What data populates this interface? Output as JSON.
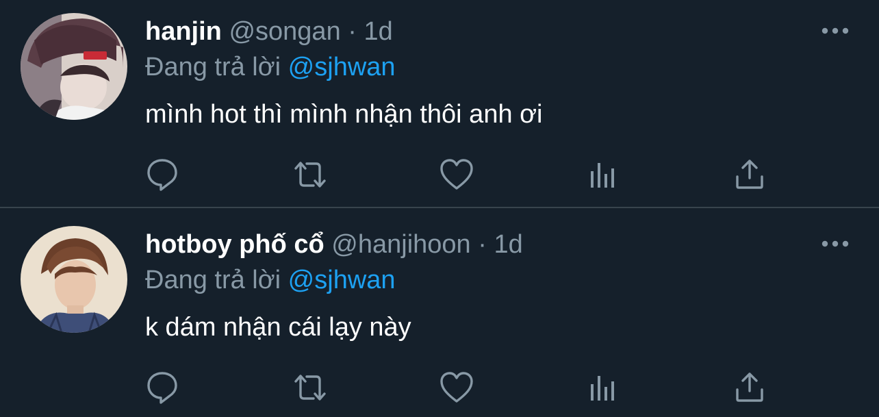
{
  "tweets": [
    {
      "display_name": "hanjin",
      "handle": "@songan",
      "separator": "·",
      "time": "1d",
      "reply_prefix": "Đang trả lời",
      "reply_to": "@sjhwan",
      "text": "mình hot thì mình nhận thôi anh ơi"
    },
    {
      "display_name": "hotboy phố cổ",
      "handle": "@hanjihoon",
      "separator": "·",
      "time": "1d",
      "reply_prefix": "Đang trả lời",
      "reply_to": "@sjhwan",
      "text": "k dám nhận cái lạy này"
    }
  ],
  "icons": {
    "more": "more-horizontal-icon",
    "reply": "reply-bubble-icon",
    "retweet": "retweet-icon",
    "like": "heart-icon",
    "stats": "analytics-icon",
    "share": "share-icon"
  },
  "colors": {
    "background": "#15202b",
    "divider": "#38444d",
    "text_primary": "#ffffff",
    "text_secondary": "#8899a6",
    "accent": "#1da1f2"
  }
}
